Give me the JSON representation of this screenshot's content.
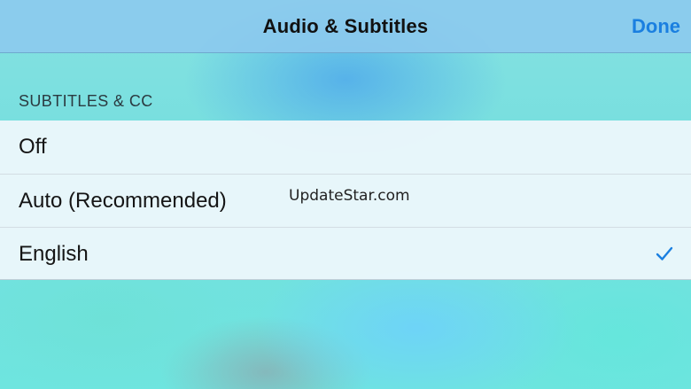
{
  "navbar": {
    "title": "Audio & Subtitles",
    "done_label": "Done"
  },
  "section": {
    "header": "SUBTITLES & CC"
  },
  "options": [
    {
      "label": "Off",
      "selected": false
    },
    {
      "label": "Auto (Recommended)",
      "selected": false
    },
    {
      "label": "English",
      "selected": true
    }
  ],
  "watermark": "UpdateStar.com",
  "colors": {
    "accent": "#1a7fe0",
    "navbar": "#8cc8ee",
    "row_background": "#f0f8fc"
  },
  "icons": {
    "selected_marker": "checkmark-icon"
  }
}
